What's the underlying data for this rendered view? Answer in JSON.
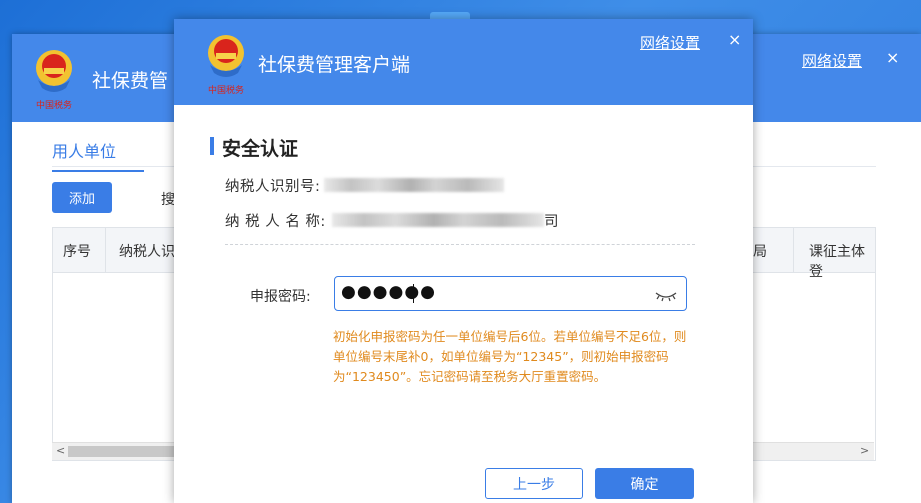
{
  "back_window": {
    "title": "社保费管",
    "network_settings": "网络设置",
    "close_glyph": "×",
    "tab": "用人单位",
    "add_button": "添加",
    "search_label": "搜",
    "columns": [
      "序号",
      "纳税人识",
      "局",
      "课征主体登"
    ],
    "scroll_left": "<",
    "scroll_right": ">"
  },
  "dialog": {
    "title": "社保费管理客户端",
    "network_settings": "网络设置",
    "close_glyph": "×",
    "section_title": "安全认证",
    "taxpayer_id_label": "纳税人识别号:",
    "taxpayer_name_label": "纳 税 人 名 称:",
    "taxpayer_name_tail": "司",
    "password_label": "申报密码:",
    "password_value": "●●●●●●",
    "hint": "初始化申报密码为任一单位编号后6位。若单位编号不足6位，则单位编号末尾补0，如单位编号为“12345”，则初始申报密码为“123450”。忘记密码请至税务大厅重置密码。",
    "prev_button": "上一步",
    "ok_button": "确定"
  },
  "logo_text": "中国税务",
  "colors": {
    "header_blue": "#4488ea",
    "accent_blue": "#3a7de6",
    "hint_orange": "#e08a1e"
  },
  "icons": {
    "logo": "tax-emblem-icon",
    "password_toggle": "eye-closed-icon"
  }
}
